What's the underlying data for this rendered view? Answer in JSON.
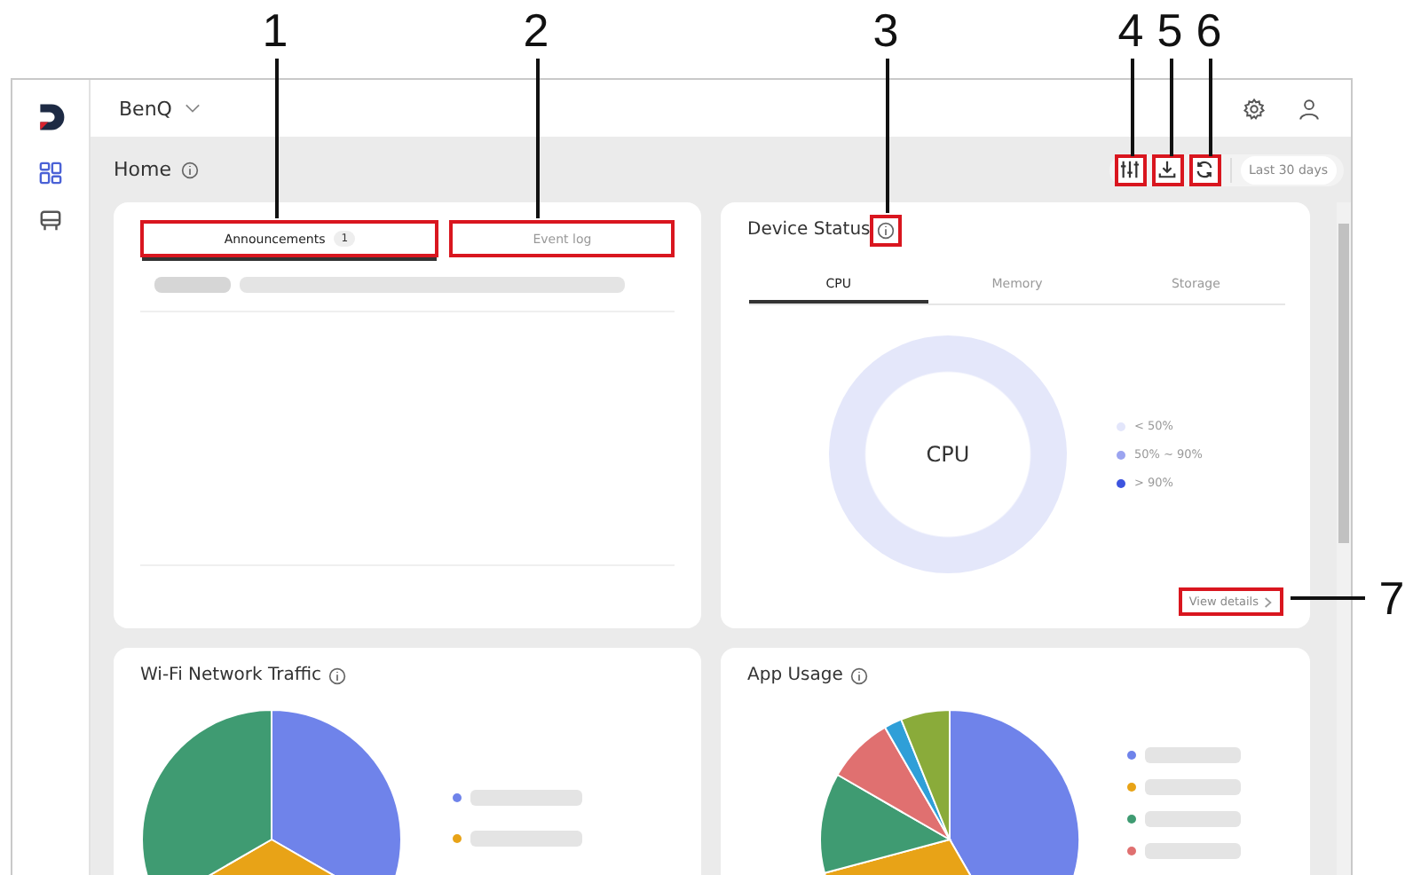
{
  "brand_menu": {
    "label": "BenQ"
  },
  "sidebar": {
    "items": [
      {
        "kind": "dashboard",
        "selected": true
      },
      {
        "kind": "device",
        "selected": false
      }
    ]
  },
  "page": {
    "title": "Home"
  },
  "toolbar": {
    "buttons": [
      {
        "kind": "filter",
        "highlighted": true
      },
      {
        "kind": "download",
        "highlighted": true
      },
      {
        "kind": "refresh",
        "highlighted": true
      }
    ],
    "date_range": "Last 30 days"
  },
  "announcements_card": {
    "tabs": [
      {
        "label": "Announcements",
        "badge": "1",
        "selected": true,
        "highlighted": true
      },
      {
        "label": "Event log",
        "selected": false,
        "highlighted": true
      }
    ]
  },
  "device_status": {
    "title": "Device Status",
    "info_highlighted": true,
    "tabs": [
      {
        "label": "CPU",
        "selected": true
      },
      {
        "label": "Memory",
        "selected": false
      },
      {
        "label": "Storage",
        "selected": false
      }
    ],
    "center_label": "CPU",
    "legend": [
      {
        "label": "< 50%",
        "color": "#e3e6fb"
      },
      {
        "label": "50% ~ 90%",
        "color": "#9ba4f0"
      },
      {
        "label": "> 90%",
        "color": "#3d54df"
      }
    ],
    "link": "View details",
    "link_highlighted": true
  },
  "wifi_traffic": {
    "title": "Wi-Fi Network Traffic",
    "legend": [
      {
        "color": "#6f83ea"
      },
      {
        "color": "#e8a317"
      }
    ]
  },
  "app_usage": {
    "title": "App Usage",
    "legend": [
      {
        "color": "#6f83ea"
      },
      {
        "color": "#e8a317"
      },
      {
        "color": "#3f9b72"
      },
      {
        "color": "#e07070"
      }
    ]
  },
  "callouts": [
    {
      "number": "1"
    },
    {
      "number": "2"
    },
    {
      "number": "3"
    },
    {
      "number": "4"
    },
    {
      "number": "5"
    },
    {
      "number": "6"
    },
    {
      "number": "7"
    }
  ]
}
